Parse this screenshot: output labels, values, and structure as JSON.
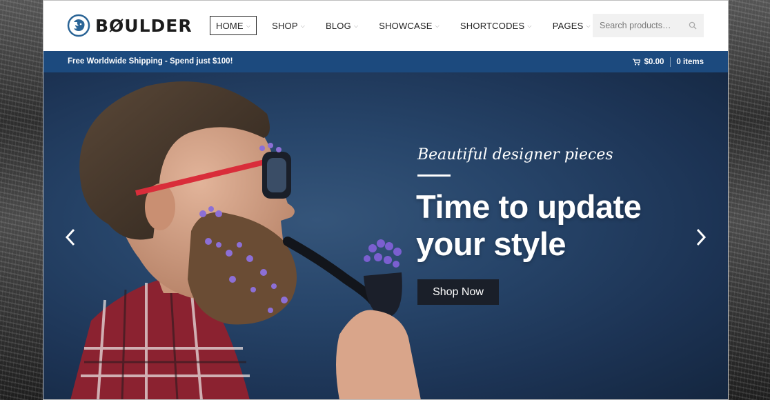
{
  "brand": {
    "name": "BØULDER",
    "accent": "#1c4a7e"
  },
  "nav": {
    "items": [
      {
        "label": "HOME",
        "active": true
      },
      {
        "label": "SHOP"
      },
      {
        "label": "BLOG"
      },
      {
        "label": "SHOWCASE"
      },
      {
        "label": "SHORTCODES"
      },
      {
        "label": "PAGES"
      }
    ]
  },
  "search": {
    "placeholder": "Search products…"
  },
  "topbar": {
    "promo": "Free Worldwide Shipping - Spend just $100!",
    "cart_total": "$0.00",
    "cart_items": "0 items"
  },
  "hero": {
    "subtitle": "Beautiful designer pieces",
    "title": "Time to update your style",
    "button": "Shop Now"
  },
  "icons": {
    "logo": "lion-head-icon",
    "search": "search-icon",
    "cart": "cart-icon",
    "prev": "chevron-left-icon",
    "next": "chevron-right-icon",
    "dropdown": "chevron-down-icon"
  }
}
